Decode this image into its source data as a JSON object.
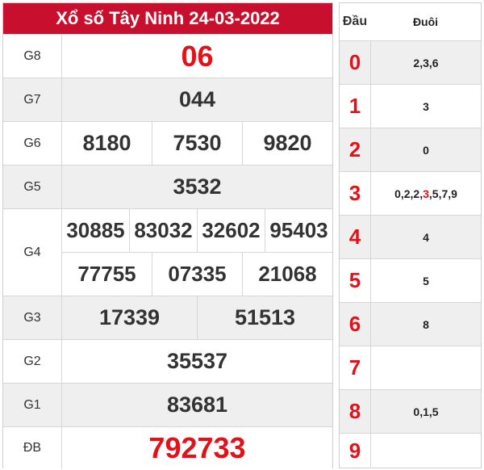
{
  "title": "Xổ số Tây Ninh 24-03-2022",
  "prizes": [
    {
      "label": "G8",
      "lines": [
        [
          "06"
        ]
      ],
      "style": "special"
    },
    {
      "label": "G7",
      "lines": [
        [
          "044"
        ]
      ]
    },
    {
      "label": "G6",
      "lines": [
        [
          "8180",
          "7530",
          "9820"
        ]
      ]
    },
    {
      "label": "G5",
      "lines": [
        [
          "3532"
        ]
      ]
    },
    {
      "label": "G4",
      "lines": [
        [
          "30885",
          "83032",
          "32602",
          "95403"
        ],
        [
          "77755",
          "07335",
          "21068"
        ]
      ]
    },
    {
      "label": "G3",
      "lines": [
        [
          "17339",
          "51513"
        ]
      ]
    },
    {
      "label": "G2",
      "lines": [
        [
          "35537"
        ]
      ]
    },
    {
      "label": "G1",
      "lines": [
        [
          "83681"
        ]
      ]
    },
    {
      "label": "ĐB",
      "lines": [
        [
          "792733"
        ]
      ],
      "style": "special"
    }
  ],
  "headtail": {
    "head_label": "Đầu",
    "tail_label": "Đuôi",
    "rows": [
      {
        "head": "0",
        "tail": "2,3,6"
      },
      {
        "head": "1",
        "tail": "3"
      },
      {
        "head": "2",
        "tail": "0"
      },
      {
        "head": "3",
        "tail_parts": [
          "0,2,2,",
          "3",
          ",5,7,9"
        ],
        "tail": "0,2,2,3,5,7,9"
      },
      {
        "head": "4",
        "tail": "4"
      },
      {
        "head": "5",
        "tail": "5"
      },
      {
        "head": "6",
        "tail": "8"
      },
      {
        "head": "7",
        "tail": ""
      },
      {
        "head": "8",
        "tail": "0,1,5"
      },
      {
        "head": "9",
        "tail": ""
      }
    ]
  },
  "colors": {
    "title_bg": "#c8102e",
    "accent": "#e0121a",
    "alt_row": "#efefef"
  }
}
